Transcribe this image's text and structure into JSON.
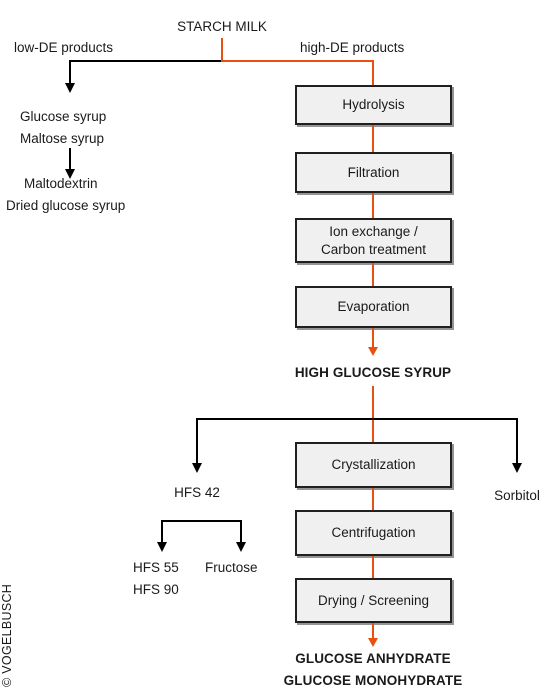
{
  "diagram": {
    "title_node": "STARCH MILK",
    "branch_labels": {
      "left": "low-DE products",
      "right": "high-DE products"
    },
    "left_products_group_1": [
      "Glucose syrup",
      "Maltose syrup"
    ],
    "left_products_group_2": [
      "Maltodextrin",
      "Dried glucose syrup"
    ],
    "process_boxes_upper": [
      {
        "label": "Hydrolysis"
      },
      {
        "label": "Filtration"
      },
      {
        "label": "Ion exchange /",
        "label2": "Carbon treatment"
      },
      {
        "label": "Evaporation"
      }
    ],
    "intermediate_product": "HIGH GLUCOSE SYRUP",
    "process_boxes_lower": [
      {
        "label": "Crystallization"
      },
      {
        "label": "Centrifugation"
      },
      {
        "label": "Drying / Screening"
      }
    ],
    "side_outputs": {
      "left": "HFS 42",
      "right": "Sorbitol"
    },
    "hfs_outputs": {
      "left_line_1": "HFS 55",
      "left_line_2": "HFS 90",
      "right": "Fructose"
    },
    "final_products": {
      "line_1": "GLUCOSE ANHYDRATE",
      "line_2": "GLUCOSE MONOHYDRATE"
    },
    "copyright": "© VOGELBUSCH",
    "colors": {
      "main_flow": "#e8500f",
      "side_flow": "#000000",
      "box_fill": "#f0f0f0",
      "box_border": "#231f20",
      "text": "#1a1a1a"
    }
  }
}
